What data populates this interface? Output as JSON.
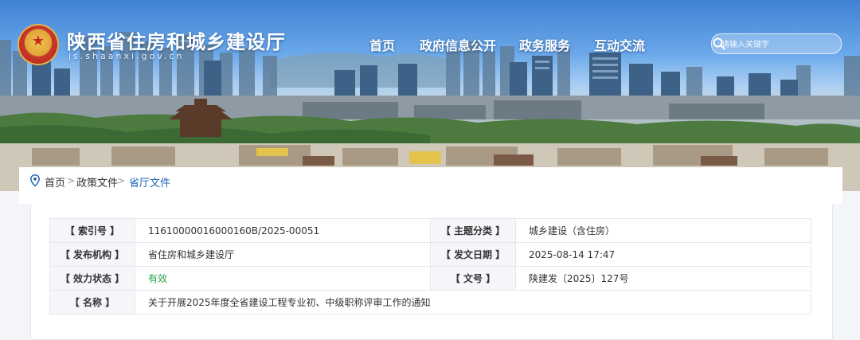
{
  "header": {
    "site_title": "陕西省住房和城乡建设厅",
    "site_domain": "js.shaanxi.gov.cn",
    "nav": [
      "首页",
      "政府信息公开",
      "政务服务",
      "互动交流"
    ],
    "search_placeholder": "请输入关键字",
    "colors": {
      "nav_text": "#ffffff",
      "sky": "#3f82d4"
    }
  },
  "breadcrumb": {
    "items": [
      "首页",
      "政策文件",
      "省厅文件"
    ],
    "separator": ">"
  },
  "info_table": {
    "rows": [
      {
        "label_left": "【 索引号 】",
        "value_left": "11610000016000160B/2025-00051",
        "label_right": "【 主题分类 】",
        "value_right": "城乡建设（含住房）"
      },
      {
        "label_left": "【 发布机构 】",
        "value_left": "省住房和城乡建设厅",
        "label_right": "【 发文日期 】",
        "value_right": "2025-08-14 17:47"
      },
      {
        "label_left": "【 效力状态 】",
        "value_left": "有效",
        "label_right": "【 文号 】",
        "value_right": "陕建发〔2025〕127号"
      }
    ],
    "title_label": "【 名称 】",
    "title_value": "关于开展2025年度全省建设工程专业初、中级职称评审工作的通知",
    "colors": {
      "label_bg": "#f4f6f9",
      "valid": "#27a34a",
      "current_crumb": "#1e63b6"
    }
  }
}
